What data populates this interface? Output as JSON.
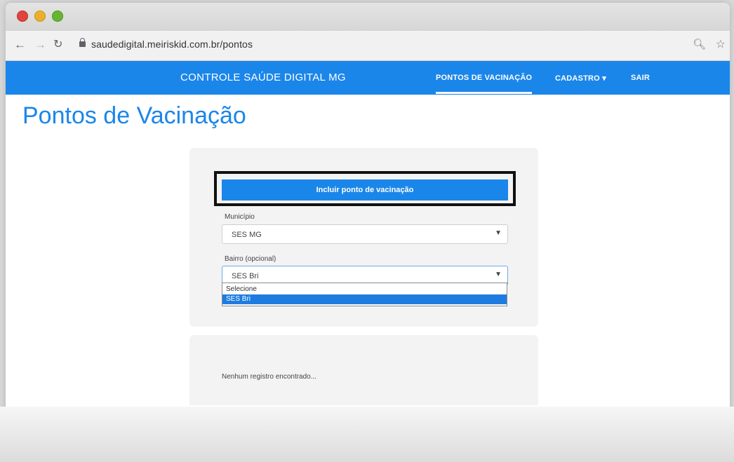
{
  "browser": {
    "url": "saudedigital.meiriskid.com.br/pontos"
  },
  "navbar": {
    "brand": "CONTROLE SAÚDE DIGITAL MG",
    "items": [
      {
        "label": "PONTOS DE VACINAÇÃO",
        "active": true
      },
      {
        "label": "CADASTRO ▾",
        "active": false
      },
      {
        "label": "SAIR",
        "active": false
      }
    ],
    "color": "#1b86ea"
  },
  "page": {
    "title": "Pontos de Vacinação"
  },
  "form": {
    "add_button_label": "Incluir ponto de vacinação",
    "municipio_label": "Município",
    "municipio_value": "SES MG",
    "bairro_label": "Bairro (opcional)",
    "bairro_value": "SES Bri",
    "bairro_options": [
      "Selecione",
      "SES Bri"
    ]
  },
  "results": {
    "empty_message": "Nenhum registro encontrado..."
  }
}
